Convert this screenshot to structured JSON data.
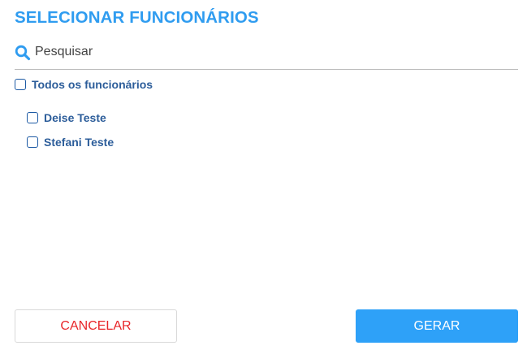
{
  "dialog": {
    "title": "SELECIONAR FUNCIONÁRIOS"
  },
  "search": {
    "placeholder": "Pesquisar",
    "value": "",
    "icon": "search-icon"
  },
  "select_all": {
    "label": "Todos os funcionários",
    "checked": false
  },
  "employees": [
    {
      "label": "Deise Teste",
      "checked": false
    },
    {
      "label": "Stefani Teste",
      "checked": false
    }
  ],
  "actions": {
    "cancel_label": "CANCELAR",
    "generate_label": "GERAR"
  },
  "colors": {
    "accent": "#2f9cf0",
    "label": "#2c5d9a",
    "cancel_text": "#e8262a",
    "generate_bg": "#2ea1f8"
  }
}
